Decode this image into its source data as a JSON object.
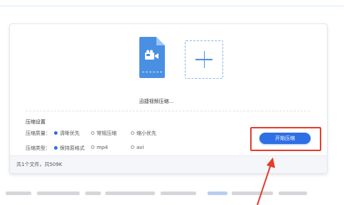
{
  "file": {
    "name": "迅捷视频压缩..."
  },
  "settings": {
    "title": "压缩设置",
    "quality": {
      "label": "压缩质量：",
      "options": [
        "清晰优先",
        "常规压缩",
        "缩小优先"
      ],
      "selected": "清晰优先"
    },
    "format": {
      "label": "压缩类型：",
      "options": [
        "保持原格式",
        "mp4",
        "avi"
      ],
      "selected": "保持原格式"
    }
  },
  "actions": {
    "start_label": "开始压缩"
  },
  "footer": {
    "summary": "共1个文件，共509K"
  },
  "colors": {
    "accent": "#2f6fe4",
    "file_icon": "#4a90e2",
    "highlight": "#e53b2c"
  },
  "icons": {
    "file": "video-file-icon",
    "add": "plus-icon"
  }
}
